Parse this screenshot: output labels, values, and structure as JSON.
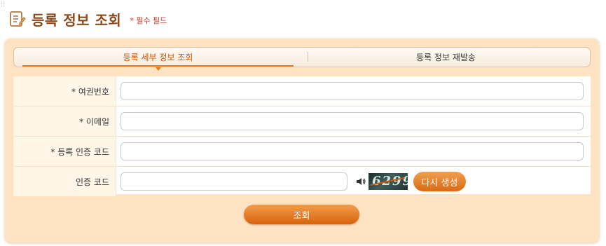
{
  "header": {
    "title": "등록 정보 조회",
    "required_note": "* 필수 필드",
    "icon": "edit-document-icon"
  },
  "tabs": [
    {
      "label": "등록 세부 정보 조회",
      "active": true
    },
    {
      "label": "등록 정보 재발송",
      "active": false
    }
  ],
  "form": {
    "passport": {
      "label": "* 여권번호",
      "value": "",
      "placeholder": ""
    },
    "email": {
      "label": "* 이메일",
      "value": "",
      "placeholder": ""
    },
    "registration_code": {
      "label": "* 등록 인증 코드",
      "value": "",
      "placeholder": ""
    },
    "captcha": {
      "label": "인증 코드",
      "value": "",
      "placeholder": "",
      "image_text": "6299",
      "audio_icon": "speaker-icon",
      "regenerate_label": "다시 생성"
    }
  },
  "submit_label": "조회",
  "colors": {
    "accent": "#e67e22",
    "title": "#8b4a1b",
    "required": "#c0392b",
    "panel": "#fde3c1"
  }
}
